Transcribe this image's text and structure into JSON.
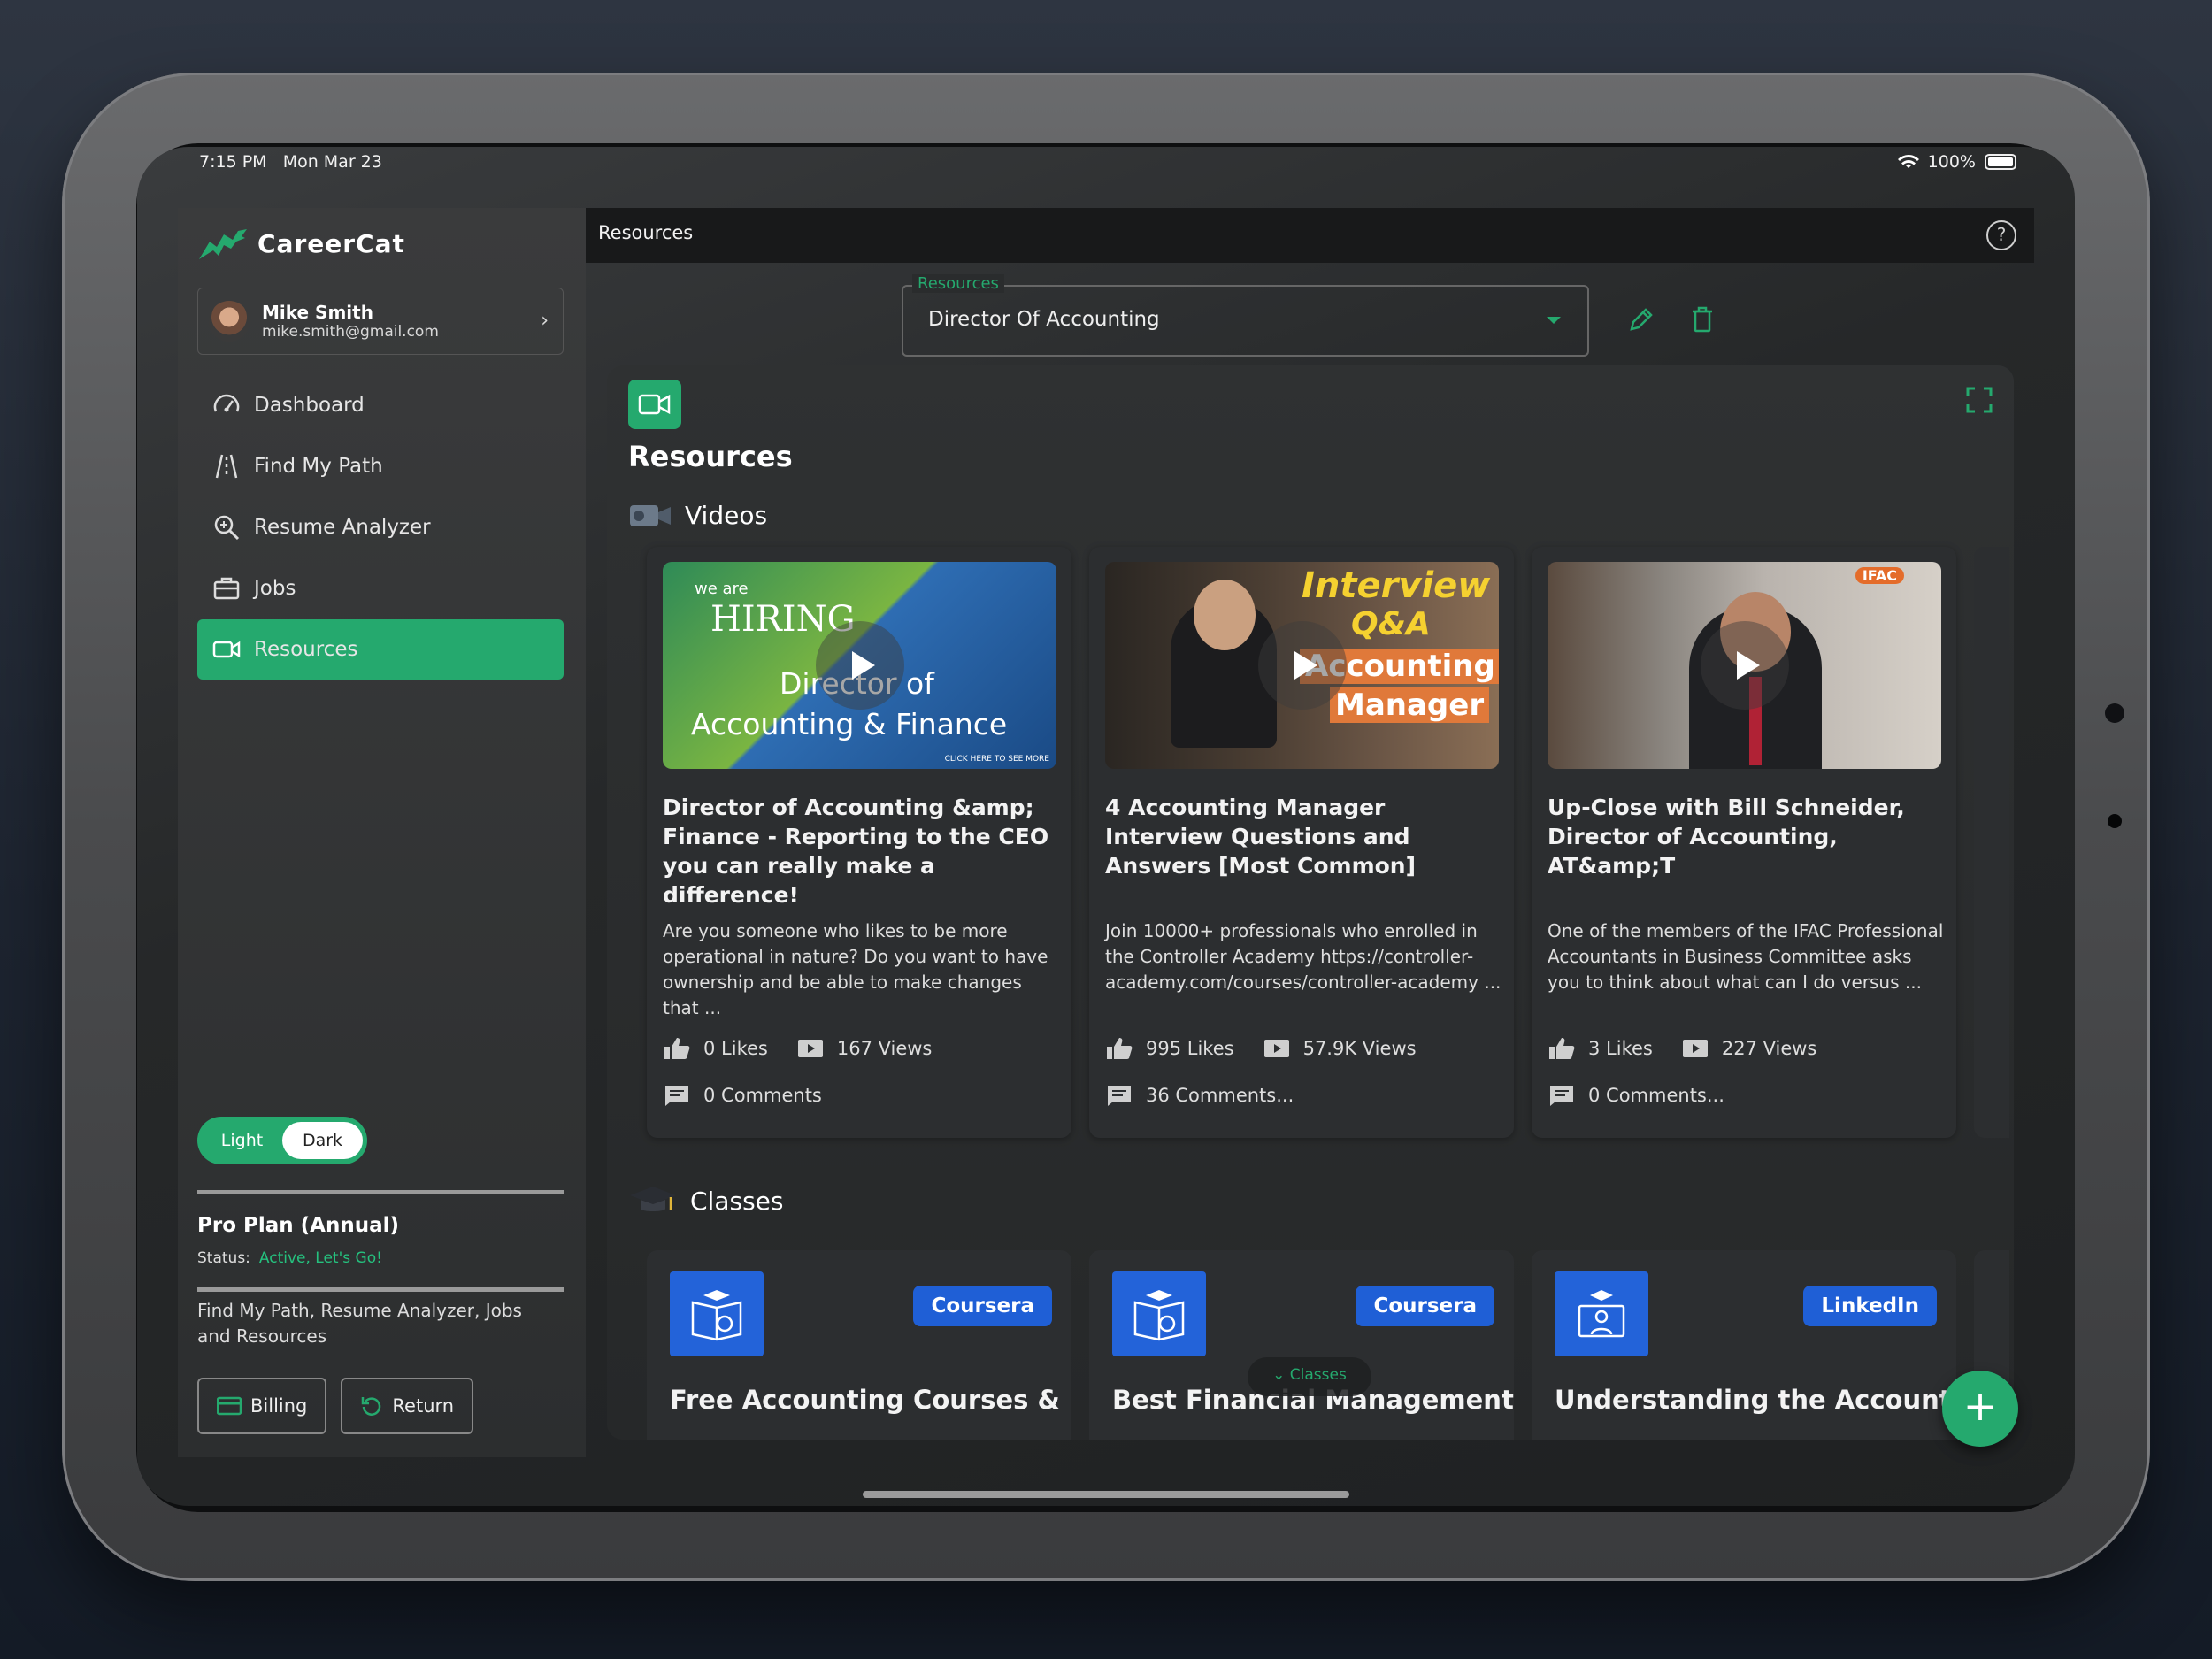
{
  "status_bar": {
    "time": "7:15 PM",
    "date": "Mon Mar 23",
    "battery": "100%"
  },
  "app": {
    "name": "CareerCat"
  },
  "user": {
    "name": "Mike Smith",
    "email": "mike.smith@gmail.com"
  },
  "nav": [
    {
      "label": "Dashboard",
      "icon": "gauge-icon"
    },
    {
      "label": "Find My Path",
      "icon": "road-icon"
    },
    {
      "label": "Resume Analyzer",
      "icon": "magnifier-icon"
    },
    {
      "label": "Jobs",
      "icon": "briefcase-icon"
    },
    {
      "label": "Resources",
      "icon": "video-camera-icon",
      "active": true
    }
  ],
  "theme_toggle": {
    "light": "Light",
    "dark": "Dark",
    "selected": "Dark"
  },
  "plan": {
    "name": "Pro Plan (Annual)",
    "status_label": "Status:",
    "status_value": "Active, Let's Go!",
    "description": "Find My Path, Resume Analyzer, Jobs and Resources",
    "billing_label": "Billing",
    "return_label": "Return"
  },
  "header": {
    "title": "Resources"
  },
  "resource_select": {
    "label": "Resources",
    "value": "Director Of Accounting"
  },
  "panel": {
    "title": "Resources",
    "videos_heading": "Videos",
    "classes_heading": "Classes"
  },
  "videos": [
    {
      "thumb_lines": [
        "we are",
        "HIRING",
        "Director of",
        "Accounting & Finance",
        "CLICK HERE TO SEE MORE"
      ],
      "title": "Director of Accounting &amp; Finance - Reporting to the CEO you can really make a difference!",
      "description": "Are you someone who likes to be more operational in nature? Do you want to have ownership and be able to make changes that ...",
      "likes": "0 Likes",
      "views": "167 Views",
      "comments": "0 Comments"
    },
    {
      "thumb_lines": [
        "Interview",
        "Q&A",
        "Accounting",
        "Manager"
      ],
      "title": "4 Accounting Manager Interview Questions and Answers [Most Common]",
      "description": "Join 10000+ professionals who enrolled in the Controller Academy https://controller-academy.com/courses/controller-academy ...",
      "likes": "995 Likes",
      "views": "57.9K Views",
      "comments": "36 Comments..."
    },
    {
      "thumb_lines": [
        "IFAC"
      ],
      "title": "Up-Close with Bill Schneider, Director of Accounting, AT&amp;T",
      "description": "One of the members of the IFAC Professional Accountants in Business Committee asks you to think about what can I do versus ...",
      "likes": "3 Likes",
      "views": "227 Views",
      "comments": "0 Comments..."
    }
  ],
  "classes": [
    {
      "provider": "Coursera",
      "title": "Free Accounting Courses &"
    },
    {
      "provider": "Coursera",
      "title": "Best Financial Management"
    },
    {
      "provider": "LinkedIn",
      "title": "Understanding the Accounting"
    }
  ],
  "floating_pill": "Classes",
  "colors": {
    "accent": "#25a96e",
    "badge_blue": "#1f5fd6",
    "sidebar": "#333435"
  }
}
